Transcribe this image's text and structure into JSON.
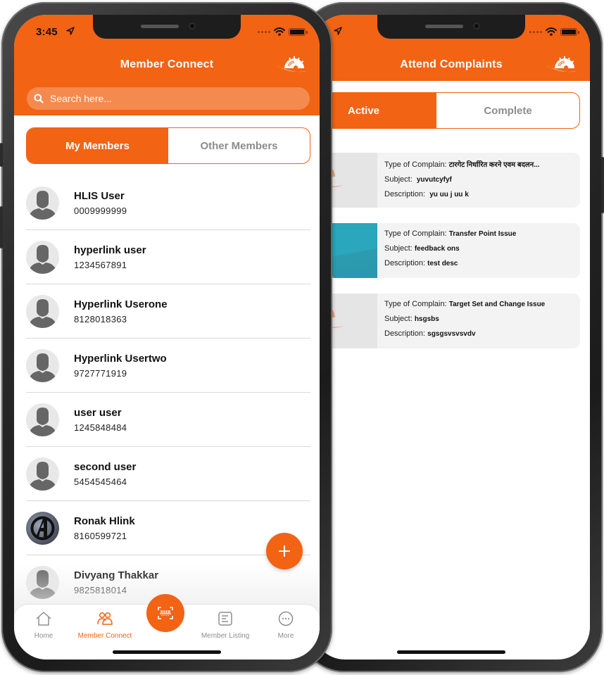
{
  "colors": {
    "accent": "#f26314",
    "inactive_text": "#8c8c8c",
    "card_bg": "#f3f3f3"
  },
  "phones": {
    "member_connect": {
      "status_bar": {
        "time": "3:45"
      },
      "header": {
        "title": "Member Connect",
        "logo_icon": "saw-blade-helmet-logo"
      },
      "search": {
        "placeholder": "Search here...",
        "value": ""
      },
      "segments": [
        {
          "label": "My Members",
          "active": true
        },
        {
          "label": "Other Members",
          "active": false
        }
      ],
      "members": [
        {
          "name": "HLIS User",
          "phone": "0009999999",
          "avatar": "default"
        },
        {
          "name": "hyperlink user",
          "phone": "1234567891",
          "avatar": "default"
        },
        {
          "name": "Hyperlink Userone",
          "phone": "8128018363",
          "avatar": "default"
        },
        {
          "name": "Hyperlink Usertwo",
          "phone": "9727771919",
          "avatar": "default"
        },
        {
          "name": "user user",
          "phone": "1245848484",
          "avatar": "default"
        },
        {
          "name": "second user",
          "phone": "5454545464",
          "avatar": "default"
        },
        {
          "name": "Ronak Hlink",
          "phone": "8160599721",
          "avatar": "photo"
        },
        {
          "name": "Divyang Thakkar",
          "phone": "9825818014",
          "avatar": "default"
        }
      ],
      "fab_icon": "plus-icon",
      "tabbar": {
        "tabs": [
          {
            "label": "Home",
            "icon": "home-icon",
            "active": false
          },
          {
            "label": "Member Connect",
            "icon": "users-icon",
            "active": true
          },
          {
            "label": "Member Listing",
            "icon": "list-icon",
            "active": false
          },
          {
            "label": "More",
            "icon": "more-icon",
            "active": false
          }
        ],
        "center_button_icon": "barcode-scan-icon"
      }
    },
    "attend_complaints": {
      "header": {
        "title": "Attend Complaints",
        "logo_icon": "saw-blade-helmet-logo"
      },
      "segments": [
        {
          "label": "Active",
          "active": true
        },
        {
          "label": "Complete",
          "active": false
        }
      ],
      "labels": {
        "type": "Type of Complain:",
        "subject": "Subject:",
        "description": "Description:"
      },
      "complaints": [
        {
          "type": "टारगेट निर्धारित करने एवम बदलन...",
          "subject": "yuvutcyfyf",
          "description": "yu uu j uu k",
          "thumb": "logo"
        },
        {
          "type": "Transfer Point Issue",
          "subject": "feedback ons",
          "description": "test desc",
          "thumb": "photo"
        },
        {
          "type": "Target Set and Change Issue",
          "subject": "hsgsbs",
          "description": "sgsgsvsvsvdv",
          "thumb": "logo"
        }
      ]
    }
  }
}
